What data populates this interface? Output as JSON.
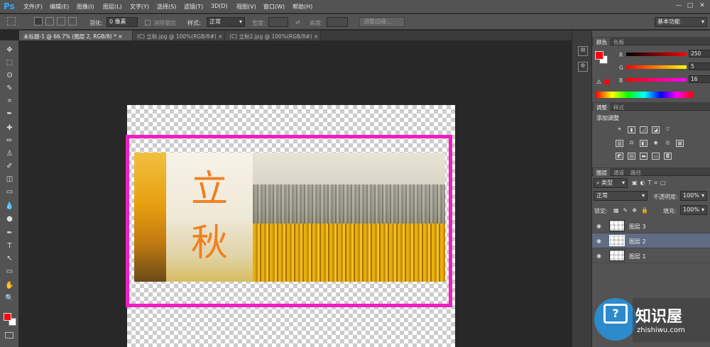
{
  "app": {
    "logo": "Ps"
  },
  "menu": [
    "文件(F)",
    "编辑(E)",
    "图像(I)",
    "图层(L)",
    "文字(Y)",
    "选择(S)",
    "滤镜(T)",
    "3D(D)",
    "视图(V)",
    "窗口(W)",
    "帮助(H)"
  ],
  "window_controls": [
    "—",
    "□",
    "✕"
  ],
  "options": {
    "feather_label": "羽化:",
    "feather_value": "0 像素",
    "antialias_label": "消除锯齿",
    "style_label": "样式:",
    "style_value": "正常",
    "width_label": "宽度:",
    "height_label": "高度:",
    "refine_edge_button": "调整边缘...",
    "workspace_value": "基本功能"
  },
  "tabs": [
    {
      "label": "未标题-1 @ 66.7% (图层 2, RGB/8) *",
      "close": "×",
      "active": true
    },
    {
      "label": "(C) 立秋.jpg @ 100%(RGB/8#)",
      "close": "×",
      "active": false
    },
    {
      "label": "(C) 立秋2.jpg @ 100%(RGB/8#)",
      "close": "×",
      "active": false
    }
  ],
  "tools": [
    "move-tool",
    "marquee-tool",
    "lasso-tool",
    "quick-select-tool",
    "crop-tool",
    "eyedropper-tool",
    "healing-brush-tool",
    "brush-tool",
    "clone-stamp-tool",
    "history-brush-tool",
    "eraser-tool",
    "gradient-tool",
    "blur-tool",
    "dodge-tool",
    "pen-tool",
    "type-tool",
    "path-select-tool",
    "shape-tool",
    "hand-tool",
    "zoom-tool"
  ],
  "tool_glyphs": [
    "✥",
    "⬚",
    "ʘ",
    "✎",
    "⌗",
    "✒",
    "✚",
    "✏",
    "♙",
    "✐",
    "◫",
    "▭",
    "💧",
    "●",
    "✒",
    "T",
    "↖",
    "▭",
    "✋",
    "🔍"
  ],
  "colors": {
    "foreground": "#fa0510",
    "background": "#ffffff",
    "selection": "#f01ec0"
  },
  "canvas": {
    "char1": "立",
    "char2": "秋"
  },
  "color_panel": {
    "tabs": [
      "颜色",
      "色板"
    ],
    "channels": [
      {
        "label": "R",
        "value": "250",
        "gradient": "#ff0000"
      },
      {
        "label": "G",
        "value": "5",
        "gradient": "#ffff00"
      },
      {
        "label": "B",
        "value": "16",
        "gradient": "#ff00ff"
      }
    ]
  },
  "adjustments_panel": {
    "tabs": [
      "调整",
      "样式"
    ],
    "title": "添加调整"
  },
  "layers_panel": {
    "tabs": [
      "图层",
      "通道",
      "路径"
    ],
    "filter_value": "类型",
    "blend_mode": "正常",
    "opacity_label": "不透明度:",
    "opacity_value": "100%",
    "lock_label": "锁定:",
    "fill_label": "填充:",
    "fill_value": "100%",
    "layers": [
      {
        "name": "图层 3",
        "active": false
      },
      {
        "name": "图层 2",
        "active": true
      },
      {
        "name": "图层 1",
        "active": false
      }
    ]
  },
  "watermark": {
    "title": "知识屋",
    "url": "zhishiwu.com"
  }
}
